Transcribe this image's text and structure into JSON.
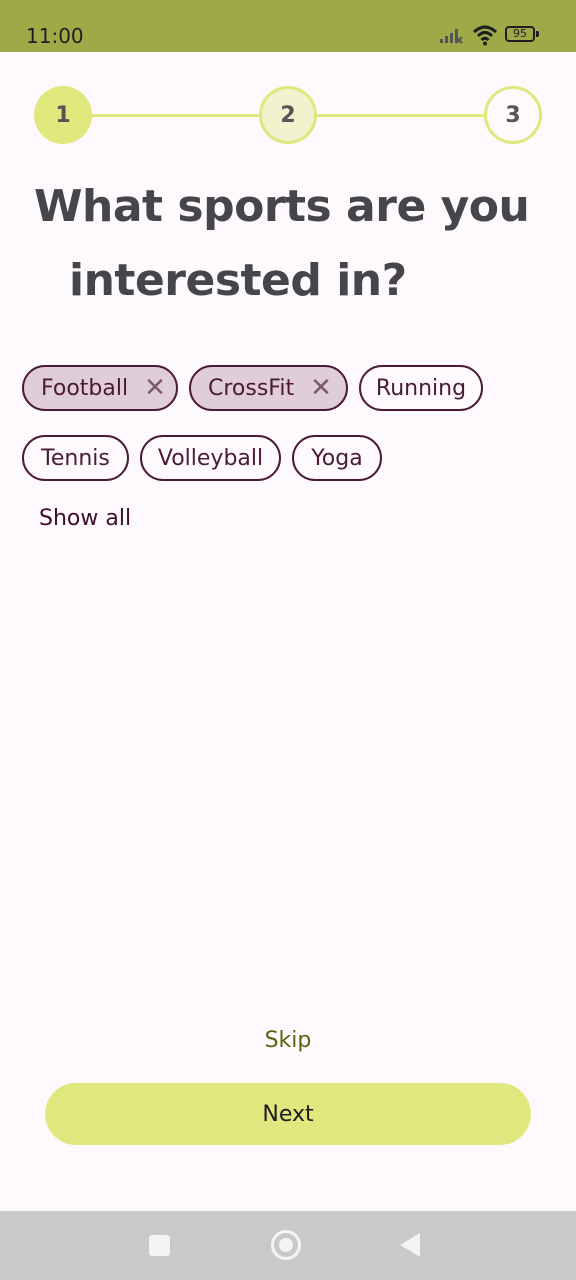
{
  "status_bar": {
    "time": "11:00",
    "battery": "95",
    "icons": [
      "signal-icon",
      "wifi-icon",
      "battery-icon"
    ]
  },
  "stepper": {
    "steps": [
      {
        "label": "1",
        "state": "active"
      },
      {
        "label": "2",
        "state": "next"
      },
      {
        "label": "3",
        "state": "pending"
      }
    ]
  },
  "title": {
    "line1": "What sports are you",
    "line2": "interested in?"
  },
  "chips": [
    {
      "label": "Football",
      "selected": true
    },
    {
      "label": "CrossFit",
      "selected": true
    },
    {
      "label": "Running",
      "selected": false
    },
    {
      "label": "Tennis",
      "selected": false
    },
    {
      "label": "Volleyball",
      "selected": false
    },
    {
      "label": "Yoga",
      "selected": false
    }
  ],
  "chip_remove_glyph": "✕",
  "show_all_label": "Show all",
  "actions": {
    "skip_label": "Skip",
    "next_label": "Next"
  },
  "nav_bar": {
    "icons": [
      "recents-icon",
      "home-icon",
      "back-icon"
    ]
  },
  "colors": {
    "status_bar": "#9eaa48",
    "accent": "#e0e77c",
    "chip_selected_bg": "#dfcdd8",
    "chip_border": "#4a1a36",
    "skip_text": "#5a6410"
  }
}
